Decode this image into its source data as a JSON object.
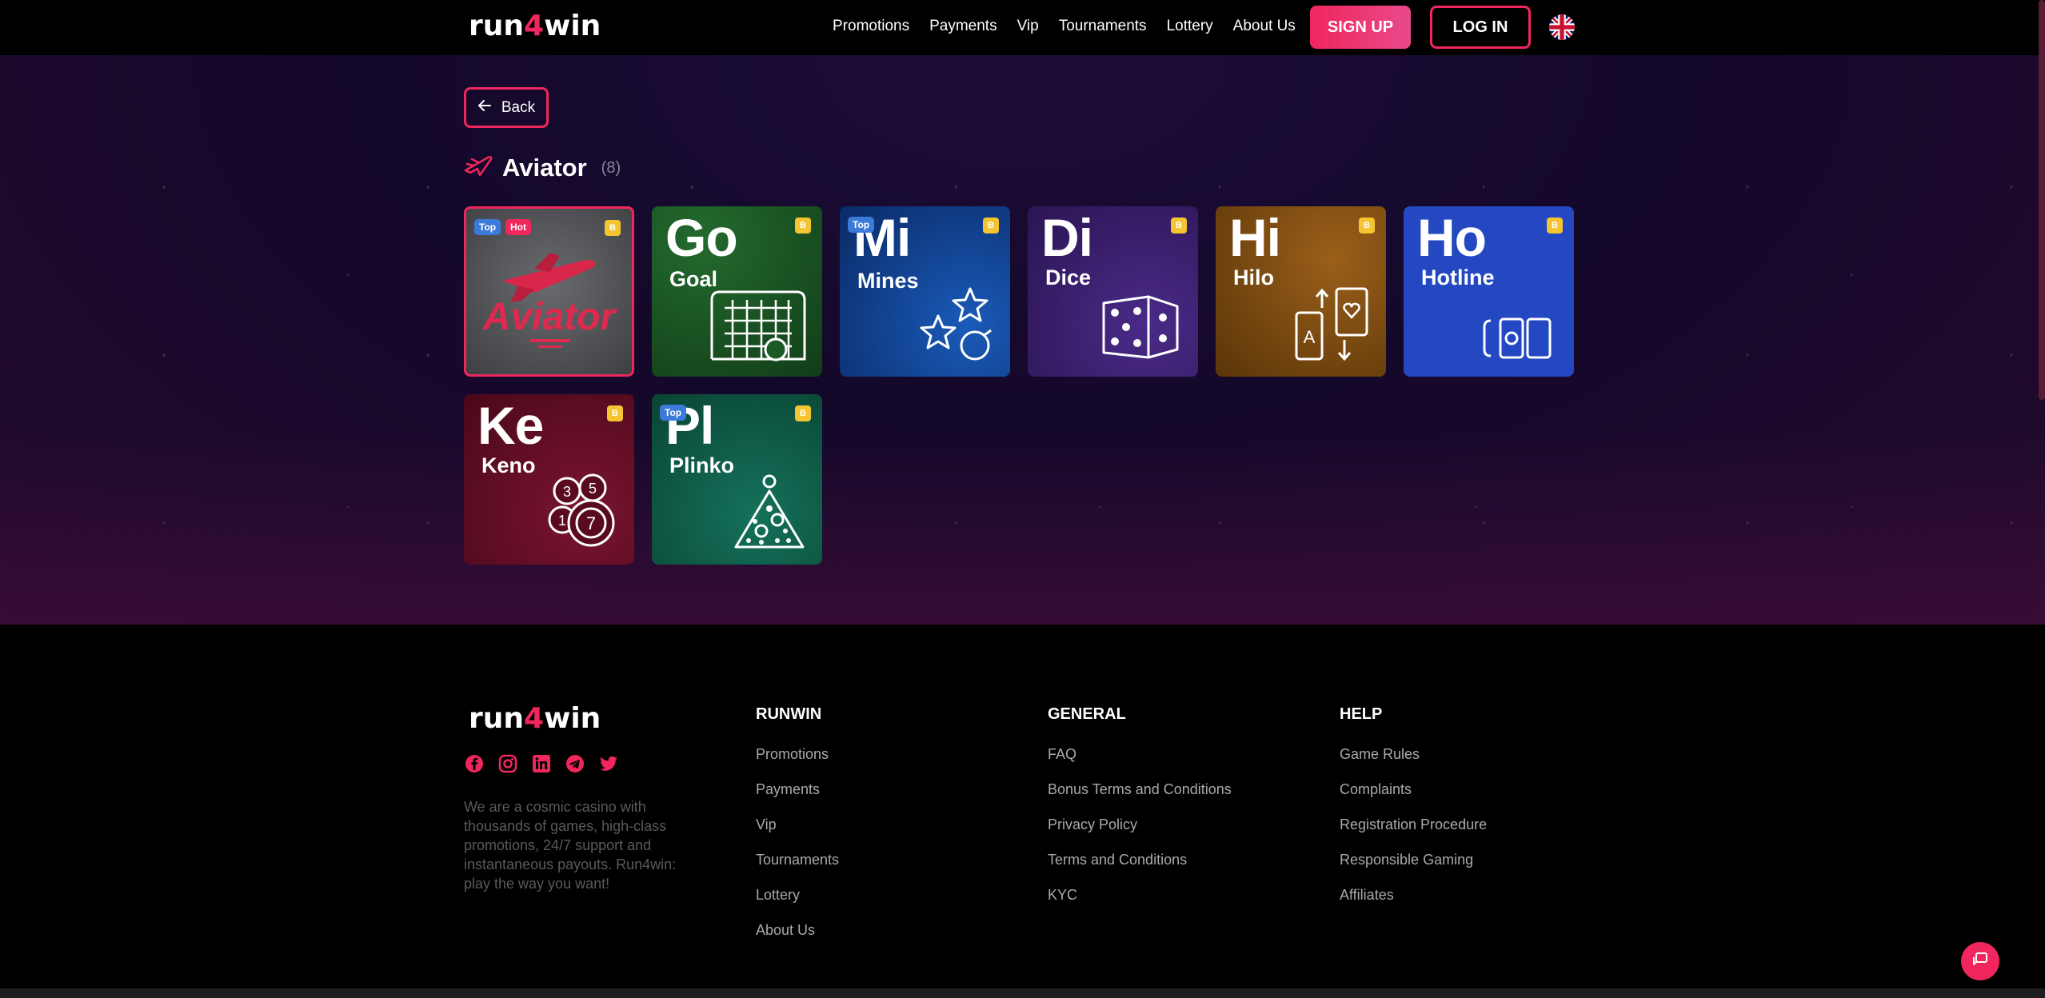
{
  "header": {
    "logo": {
      "part1": "run",
      "part2": "4",
      "part3": "win"
    },
    "nav": [
      "Promotions",
      "Payments",
      "Vip",
      "Tournaments",
      "Lottery",
      "About Us"
    ],
    "signup_label": "SIGN UP",
    "login_label": "LOG IN"
  },
  "main": {
    "back_label": "Back",
    "section_title": "Aviator",
    "section_count": "(8)",
    "coin_symbol": "B",
    "games": [
      {
        "abbr": "",
        "name": "Aviator",
        "badges": [
          "Top",
          "Hot"
        ],
        "bg": "#5a5b5e"
      },
      {
        "abbr": "Go",
        "name": "Goal",
        "badges": [],
        "bg": "#1b5a25"
      },
      {
        "abbr": "Mi",
        "name": "Mines",
        "badges": [
          "Top"
        ],
        "bg": "#0d3d8a"
      },
      {
        "abbr": "Di",
        "name": "Dice",
        "badges": [],
        "bg": "#3a1a66"
      },
      {
        "abbr": "Hi",
        "name": "Hilo",
        "badges": [],
        "bg": "#7a4a12"
      },
      {
        "abbr": "Ho",
        "name": "Hotline",
        "badges": [],
        "bg": "#2348c2"
      },
      {
        "abbr": "Ke",
        "name": "Keno",
        "badges": [],
        "bg": "#6a0d25"
      },
      {
        "abbr": "Pl",
        "name": "Plinko",
        "badges": [
          "Top"
        ],
        "bg": "#0d5a43"
      }
    ],
    "aviator_art_text": "Aviator"
  },
  "footer": {
    "about": "We are a cosmic casino with thousands of games, high-class promotions, 24/7 support and instantaneous payouts. Run4win: play the way you want!",
    "columns": [
      {
        "title": "RUNWIN",
        "links": [
          "Promotions",
          "Payments",
          "Vip",
          "Tournaments",
          "Lottery",
          "About Us"
        ]
      },
      {
        "title": "GENERAL",
        "links": [
          "FAQ",
          "Bonus Terms and Conditions",
          "Privacy Policy",
          "Terms and Conditions",
          "KYC"
        ]
      },
      {
        "title": "HELP",
        "links": [
          "Game Rules",
          "Complaints",
          "Registration Procedure",
          "Responsible Gaming",
          "Affiliates"
        ]
      }
    ],
    "socials": [
      "facebook-icon",
      "instagram-icon",
      "linkedin-icon",
      "telegram-icon",
      "twitter-icon"
    ]
  },
  "colors": {
    "accent": "#f0265d",
    "coin": "#f5c431",
    "badge_top": "#3b7ad9"
  }
}
